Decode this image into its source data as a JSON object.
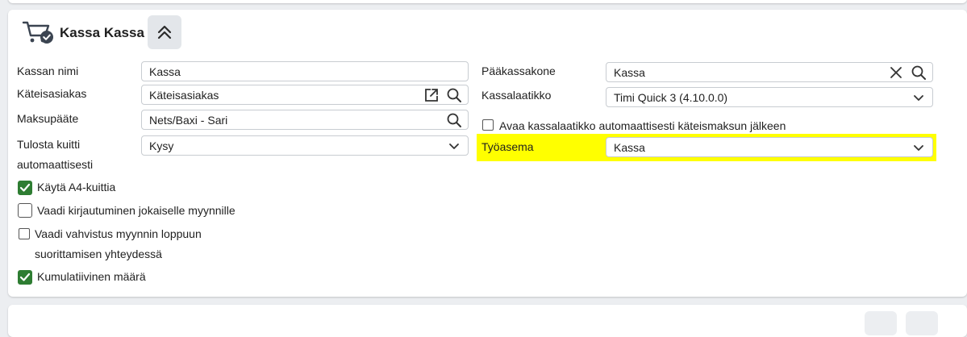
{
  "section": {
    "title": "Kassa Kassa",
    "icon": "cart-check-icon",
    "collapse_icon": "double-chevron-up-icon"
  },
  "left_fields": {
    "kassan_nimi": {
      "label": "Kassan nimi",
      "value": "Kassa"
    },
    "kateisasiakas": {
      "label": "Käteisasiakas",
      "value": "Käteisasiakas"
    },
    "maksupaate": {
      "label": "Maksupääte",
      "value": "Nets/Baxi - Sari"
    },
    "tulosta_kuitti": {
      "label_line1": "Tulosta kuitti",
      "label_line2": "automaattisesti",
      "value": "Kysy"
    }
  },
  "right_fields": {
    "paakassakone": {
      "label": "Pääkassakone",
      "value": "Kassa"
    },
    "kassalaatikko": {
      "label": "Kassalaatikko",
      "value": "Timi Quick 3 (4.10.0.0)"
    },
    "avaa_kassalaatikko": {
      "label": "Avaa kassalaatikko automaattisesti käteismaksun jälkeen",
      "checked": false
    },
    "tyoasema": {
      "label": "Työasema",
      "value": "Kassa"
    }
  },
  "checkboxes": {
    "a4": {
      "label": "Käytä A4-kuittia",
      "checked": true
    },
    "kirjautuminen": {
      "label": "Vaadi kirjautuminen jokaiselle myynnille",
      "checked": false
    },
    "vahvistus": {
      "label_line1": "Vaadi vahvistus myynnin loppuun",
      "label_line2": "suorittamisen yhteydessä",
      "checked": false
    },
    "kumulatiivinen": {
      "label": "Kumulatiivinen määrä",
      "checked": true
    }
  },
  "colors": {
    "highlight": "#ffff00",
    "checkbox_checked": "#2e7d32",
    "icon_dark": "#3b4451"
  }
}
